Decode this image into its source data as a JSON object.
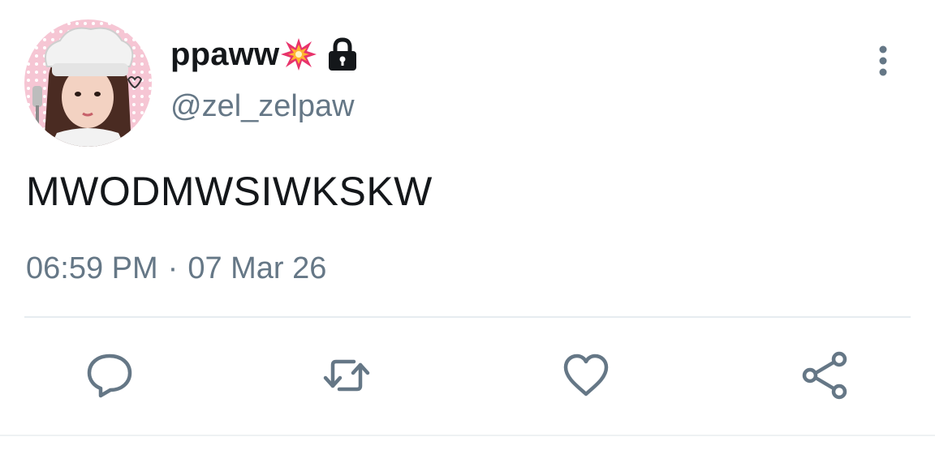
{
  "user": {
    "display_name": "ppaww",
    "name_emoji": "collision-icon",
    "protected_badge": "lock-icon",
    "handle": "@zel_zelpaw"
  },
  "tweet": {
    "text": "MWODMWSIWKSKW",
    "time": "06:59 PM",
    "separator": "·",
    "date": "07 Mar 26"
  },
  "actions": [
    {
      "name": "reply",
      "icon": "reply-icon"
    },
    {
      "name": "retweet",
      "icon": "retweet-icon"
    },
    {
      "name": "like",
      "icon": "heart-icon"
    },
    {
      "name": "share",
      "icon": "share-icon"
    }
  ],
  "menu": {
    "icon": "more-vertical-icon"
  },
  "colors": {
    "text": "#14171a",
    "secondary": "#657786",
    "divider": "#e6ecf0",
    "accent_burst": "#e8336b"
  }
}
